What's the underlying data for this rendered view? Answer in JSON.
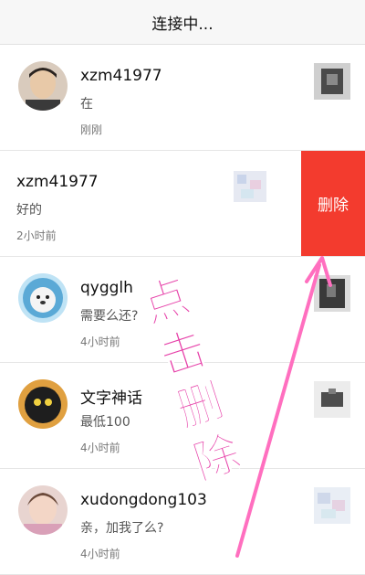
{
  "header": {
    "title": "连接中..."
  },
  "conversations": [
    {
      "name": "xzm41977",
      "message": "在",
      "time": "刚刚"
    },
    {
      "name": "xzm41977",
      "message": "好的",
      "time": "2小时前"
    },
    {
      "name": "qygglh",
      "message": "需要么还?",
      "time": "4小时前"
    },
    {
      "name": "文字神话",
      "message": "最低100",
      "time": "4小时前"
    },
    {
      "name": "xudongdong103",
      "message": "亲，加我了么?",
      "time": "4小时前"
    }
  ],
  "row_action": {
    "delete_label": "删除"
  },
  "annotation": {
    "text": "点击删除",
    "chars": [
      "点",
      "击",
      "删",
      "除"
    ]
  },
  "colors": {
    "delete_bg": "#f33b2e",
    "annotation": "#e63fa8"
  }
}
